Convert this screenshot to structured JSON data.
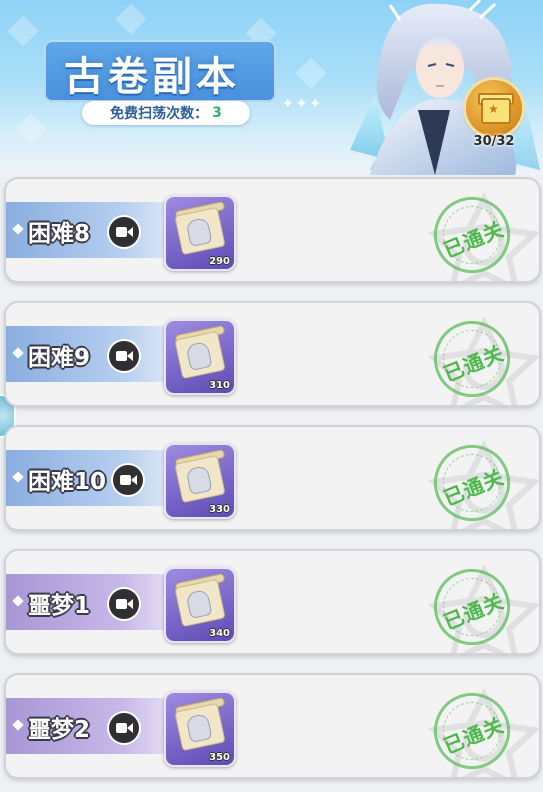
{
  "header": {
    "title": "古卷副本",
    "sweep_label": "免费扫荡次数：",
    "sweep_count": "3",
    "sparkles": "✦✦✦"
  },
  "gift": {
    "icon": "gift-icon",
    "count": "30/32"
  },
  "levels": [
    {
      "name": "困难8",
      "difficulty": "hard",
      "reward_qty": "290",
      "status": "已通关"
    },
    {
      "name": "困难9",
      "difficulty": "hard",
      "reward_qty": "310",
      "status": "已通关"
    },
    {
      "name": "困难10",
      "difficulty": "hard",
      "reward_qty": "330",
      "status": "已通关"
    },
    {
      "name": "噩梦1",
      "difficulty": "nightmare",
      "reward_qty": "340",
      "status": "已通关"
    },
    {
      "name": "噩梦2",
      "difficulty": "nightmare",
      "reward_qty": "350",
      "status": "已通关"
    }
  ],
  "colors": {
    "hard_tag": "#8aaedf",
    "nightmare_tag": "#a896d4",
    "stamp_green": "#4cba4c",
    "banner_blue": "#8fd2f7"
  },
  "icons": {
    "video": "video-camera-icon",
    "reward": "scroll-icon",
    "cleared": "cleared-stamp-icon"
  }
}
